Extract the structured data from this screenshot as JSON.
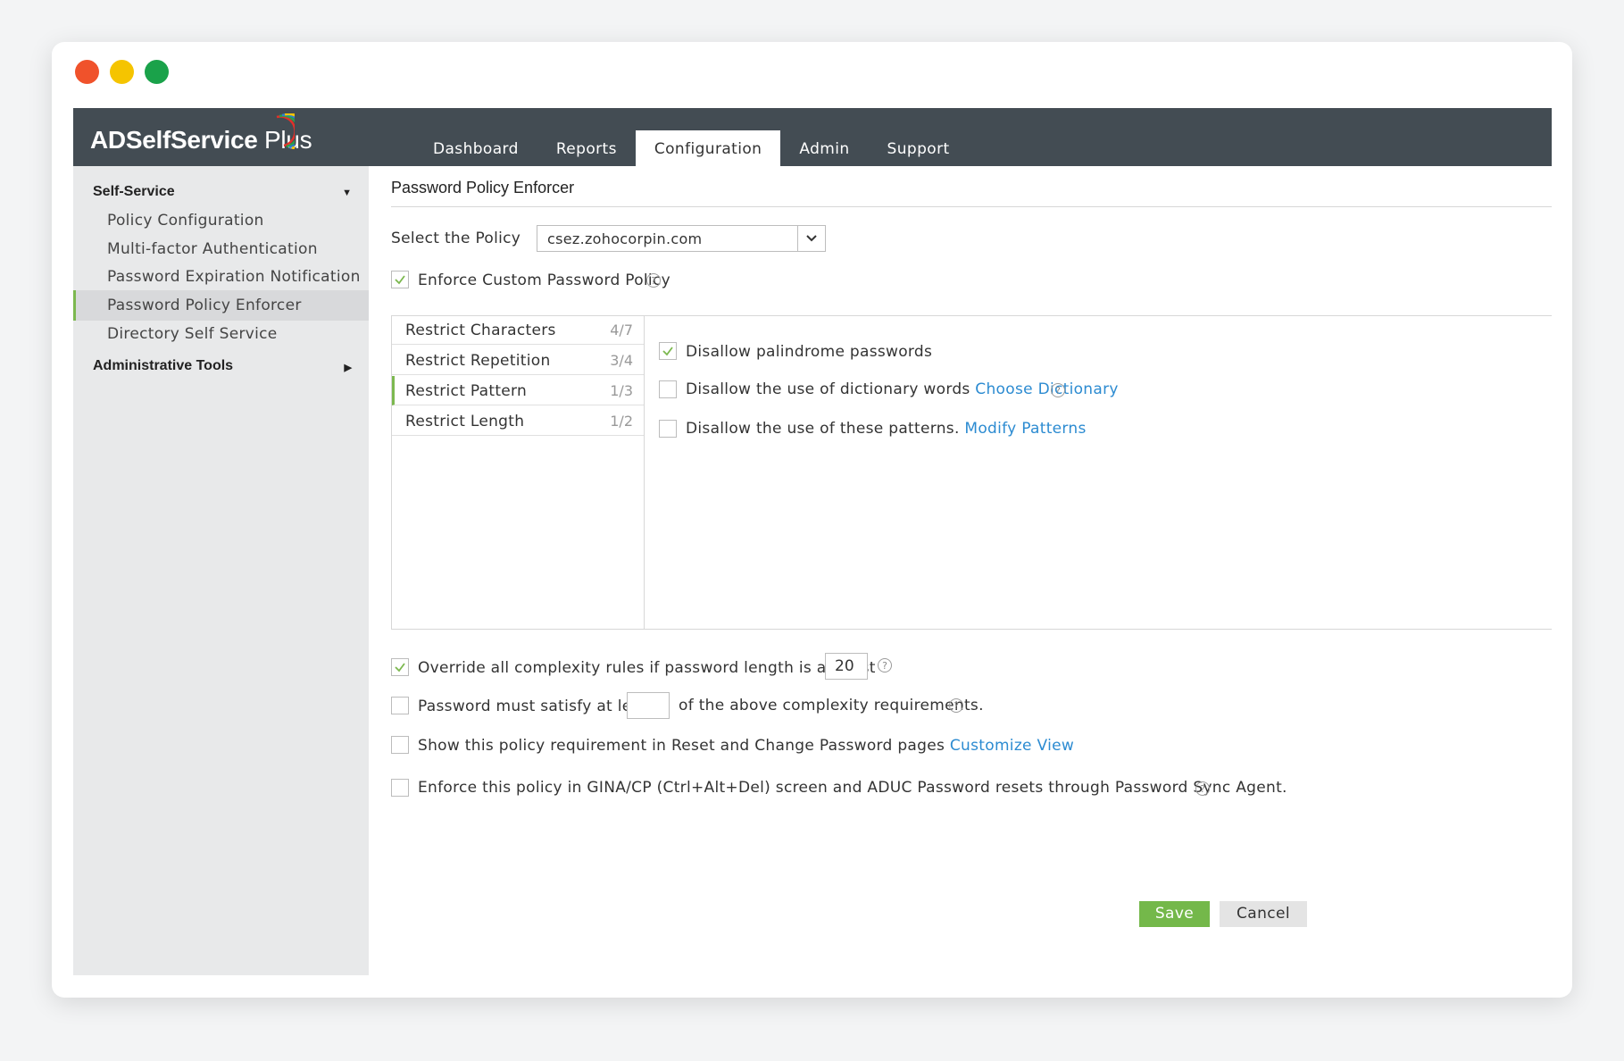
{
  "app": {
    "logo_main": "ADSelfService",
    "logo_plus": "Plus"
  },
  "nav": {
    "tabs": [
      {
        "label": "Dashboard"
      },
      {
        "label": "Reports"
      },
      {
        "label": "Configuration",
        "active": true
      },
      {
        "label": "Admin"
      },
      {
        "label": "Support"
      }
    ]
  },
  "sidebar": {
    "section1": "Self-Service",
    "items": [
      {
        "label": "Policy Configuration"
      },
      {
        "label": "Multi-factor Authentication"
      },
      {
        "label": "Password Expiration Notification"
      },
      {
        "label": "Password Policy Enforcer",
        "active": true
      },
      {
        "label": "Directory Self Service"
      }
    ],
    "section2": "Administrative Tools"
  },
  "page": {
    "title": "Password Policy Enforcer",
    "select_label": "Select the Policy",
    "select_value": "csez.zohocorpin.com",
    "enforce_label": "Enforce Custom Password Policy",
    "enforce_checked": true
  },
  "rules": [
    {
      "name": "Restrict Characters",
      "count": "4/7"
    },
    {
      "name": "Restrict Repetition",
      "count": "3/4"
    },
    {
      "name": "Restrict Pattern",
      "count": "1/3",
      "active": true
    },
    {
      "name": "Restrict Length",
      "count": "1/2"
    }
  ],
  "pattern_options": {
    "palindrome": {
      "label": "Disallow palindrome passwords",
      "checked": true
    },
    "dictionary": {
      "label": "Disallow the use of dictionary words",
      "link": "Choose Dictionary",
      "checked": false
    },
    "patterns": {
      "label": "Disallow the use of these patterns.",
      "link": "Modify Patterns",
      "checked": false
    }
  },
  "options": {
    "override": {
      "label": "Override all complexity rules if password length is at least",
      "value": "20",
      "checked": true
    },
    "satisfy": {
      "label_before": "Password must satisfy at least",
      "label_after": "of the above complexity requirements.",
      "value": "",
      "checked": false
    },
    "show_policy": {
      "label": "Show this policy requirement in Reset and Change Password pages",
      "link": "Customize View",
      "checked": false
    },
    "gina": {
      "label": "Enforce this policy in GINA/CP (Ctrl+Alt+Del) screen and ADUC Password resets through Password Sync Agent.",
      "checked": false
    }
  },
  "buttons": {
    "save": "Save",
    "cancel": "Cancel"
  },
  "colors": {
    "topbar": "#434c53",
    "accent_green": "#74b84a",
    "link": "#2c8bd1"
  }
}
